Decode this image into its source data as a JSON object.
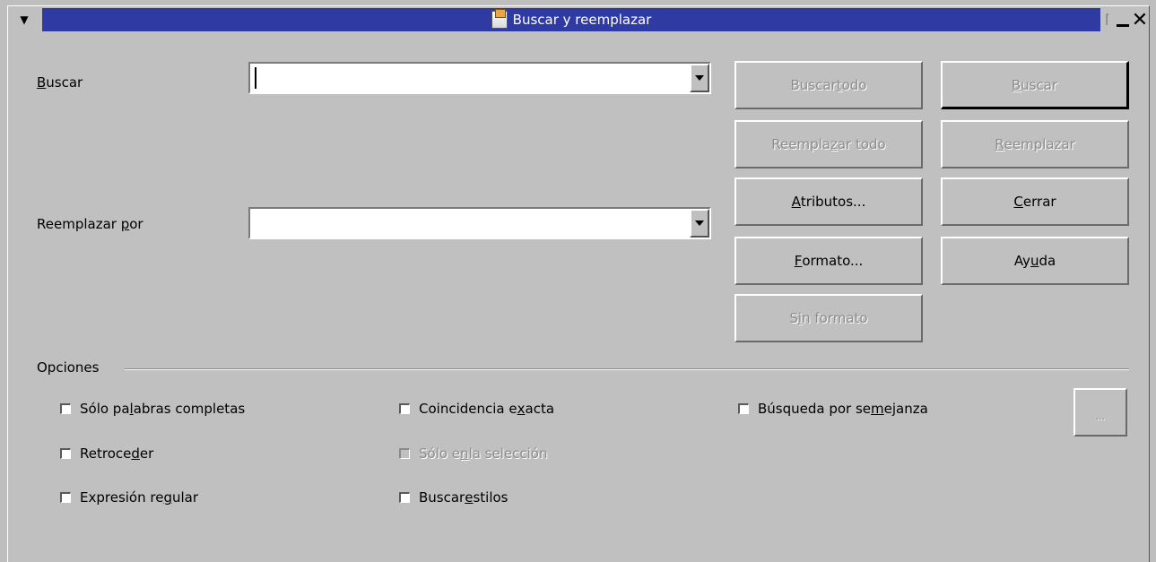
{
  "window": {
    "title": "Buscar y reemplazar",
    "menu_glyph": "▼",
    "separator_glyph": "⌈",
    "close_glyph": "✕"
  },
  "search": {
    "label_u": "B",
    "label_rest": "uscar",
    "value": ""
  },
  "replace": {
    "label_pre": "Reemplazar ",
    "label_u": "p",
    "label_rest": "or",
    "value": ""
  },
  "buttons": {
    "find_all": {
      "pre": "Buscar ",
      "u": "t",
      "post": "odo"
    },
    "find": {
      "pre": "",
      "u": "B",
      "post": "uscar"
    },
    "replace_all": {
      "pre": "Reempla",
      "u": "z",
      "post": "ar todo"
    },
    "replace": {
      "pre": "",
      "u": "R",
      "post": "eemplazar"
    },
    "attributes": {
      "pre": "",
      "u": "A",
      "post": "tributos..."
    },
    "close": {
      "pre": "",
      "u": "C",
      "post": "errar"
    },
    "format": {
      "pre": "",
      "u": "F",
      "post": "ormato..."
    },
    "help": {
      "pre": "Ay",
      "u": "u",
      "post": "da"
    },
    "no_format": {
      "pre": "S",
      "u": "i",
      "post": "n formato"
    },
    "more": "..."
  },
  "options": {
    "group_label": "Opciones",
    "whole_words": {
      "pre": "Sólo pa",
      "u": "l",
      "post": "abras completas"
    },
    "match_case": {
      "pre": "Coincidencia e",
      "u": "x",
      "post": "acta"
    },
    "similarity": {
      "pre": "Búsqueda por se",
      "u": "m",
      "post": "ejanza"
    },
    "backwards": {
      "pre": "Retroce",
      "u": "d",
      "post": "er"
    },
    "selection_only": {
      "pre": "Sólo e",
      "u": "n",
      "post": " la selección"
    },
    "regex": {
      "pre": "Expresión re",
      "u": "g",
      "post": "ular"
    },
    "styles": {
      "pre": "Buscar ",
      "u": "e",
      "post": "stilos"
    }
  }
}
